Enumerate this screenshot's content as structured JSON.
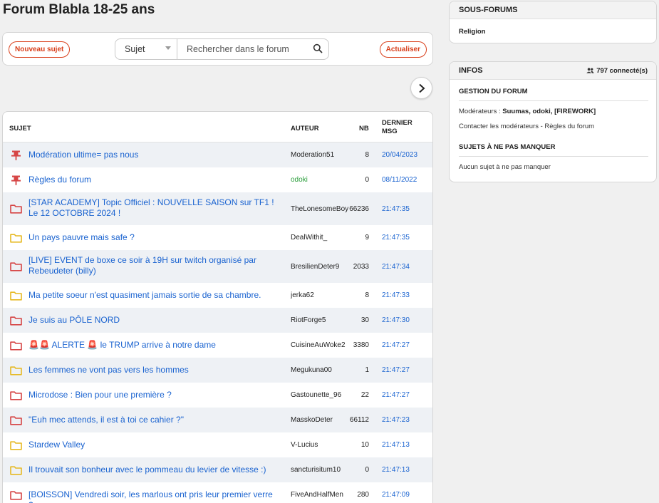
{
  "page": {
    "title": "Forum Blabla 18-25 ans"
  },
  "toolbar": {
    "new_topic": "Nouveau sujet",
    "refresh": "Actualiser",
    "search_scope": "Sujet",
    "search_placeholder": "Rechercher dans le forum"
  },
  "table": {
    "headers": {
      "subject": "SUJET",
      "author": "AUTEUR",
      "count": "NB",
      "last_line1": "DERNIER",
      "last_line2": "MSG"
    },
    "rows": [
      {
        "icon": "pin-icon",
        "title": "Modération ultime= pas nous",
        "author": "Moderation51",
        "count": "8",
        "date": "20/04/2023"
      },
      {
        "icon": "pin-icon",
        "title": "Règles du forum",
        "author": "odoki",
        "count": "0",
        "date": "08/11/2022",
        "author_color": "green"
      },
      {
        "icon": "folder-red-icon",
        "title": "[STAR ACADEMY] Topic Officiel : NOUVELLE SAISON sur TF1 ! Le 12 OCTOBRE 2024 !",
        "author": "TheLonesomeBoy",
        "count": "66236",
        "date": "21:47:35",
        "tall": true
      },
      {
        "icon": "folder-yellow-icon",
        "title": "Un pays pauvre mais safe ?",
        "author": "DealWithit_",
        "count": "9",
        "date": "21:47:35"
      },
      {
        "icon": "folder-red-icon",
        "title": "[LIVE] EVENT de boxe ce soir à 19H sur twitch organisé par Rebeudeter (billy)",
        "author": "BresilienDeter9",
        "count": "2033",
        "date": "21:47:34",
        "tall": true
      },
      {
        "icon": "folder-yellow-icon",
        "title": "Ma petite soeur n'est quasiment jamais sortie de sa chambre.",
        "author": "jerka62",
        "count": "8",
        "date": "21:47:33"
      },
      {
        "icon": "folder-red-icon",
        "title": "Je suis au PÔLE NORD",
        "author": "RiotForge5",
        "count": "30",
        "date": "21:47:30"
      },
      {
        "icon": "folder-red-icon",
        "title": "🚨🚨 ALERTE 🚨 le TRUMP arrive à notre dame",
        "author": "CuisineAuWoke2",
        "count": "3380",
        "date": "21:47:27"
      },
      {
        "icon": "folder-yellow-icon",
        "title": "Les femmes ne vont pas vers les hommes",
        "author": "Megukuna00",
        "count": "1",
        "date": "21:47:27"
      },
      {
        "icon": "folder-red-icon",
        "title": "Microdose : Bien pour une première ?",
        "author": "Gastounette_96",
        "count": "22",
        "date": "21:47:27"
      },
      {
        "icon": "folder-red-icon",
        "title": "\"Euh mec attends, il est à toi ce cahier ?\"",
        "author": "MasskoDeter",
        "count": "66112",
        "date": "21:47:23"
      },
      {
        "icon": "folder-yellow-icon",
        "title": "Stardew Valley",
        "author": "V-Lucius",
        "count": "10",
        "date": "21:47:13"
      },
      {
        "icon": "folder-yellow-icon",
        "title": "Il trouvait son bonheur avec le pommeau du levier de vitesse :)",
        "author": "sancturisitum10",
        "count": "0",
        "date": "21:47:13"
      },
      {
        "icon": "folder-red-icon",
        "title": "[BOISSON] Vendredi soir, les marlous ont pris leur premier verre ?",
        "author": "FiveAndHalfMen",
        "count": "280",
        "date": "21:47:09"
      }
    ]
  },
  "sidebar": {
    "sous_forums": {
      "title": "SOUS-FORUMS",
      "link": "Religion"
    },
    "infos": {
      "title": "INFOS",
      "online": "797 connecté(s)",
      "gestion_title": "GESTION DU FORUM",
      "moderators_label": "Modérateurs : ",
      "moderators": "Suumas, odoki, [FIREWORK]",
      "contact": "Contacter les modérateurs - Règles du forum",
      "sujets_title": "SUJETS À NE PAS MANQUER",
      "sujets_none": "Aucun sujet à ne pas manquer"
    }
  },
  "colors": {
    "accent": "#d9401c",
    "link": "#1a63d0",
    "folder_red": "#d64545",
    "folder_yellow": "#e6b923",
    "row_alt": "#eef1f5"
  }
}
